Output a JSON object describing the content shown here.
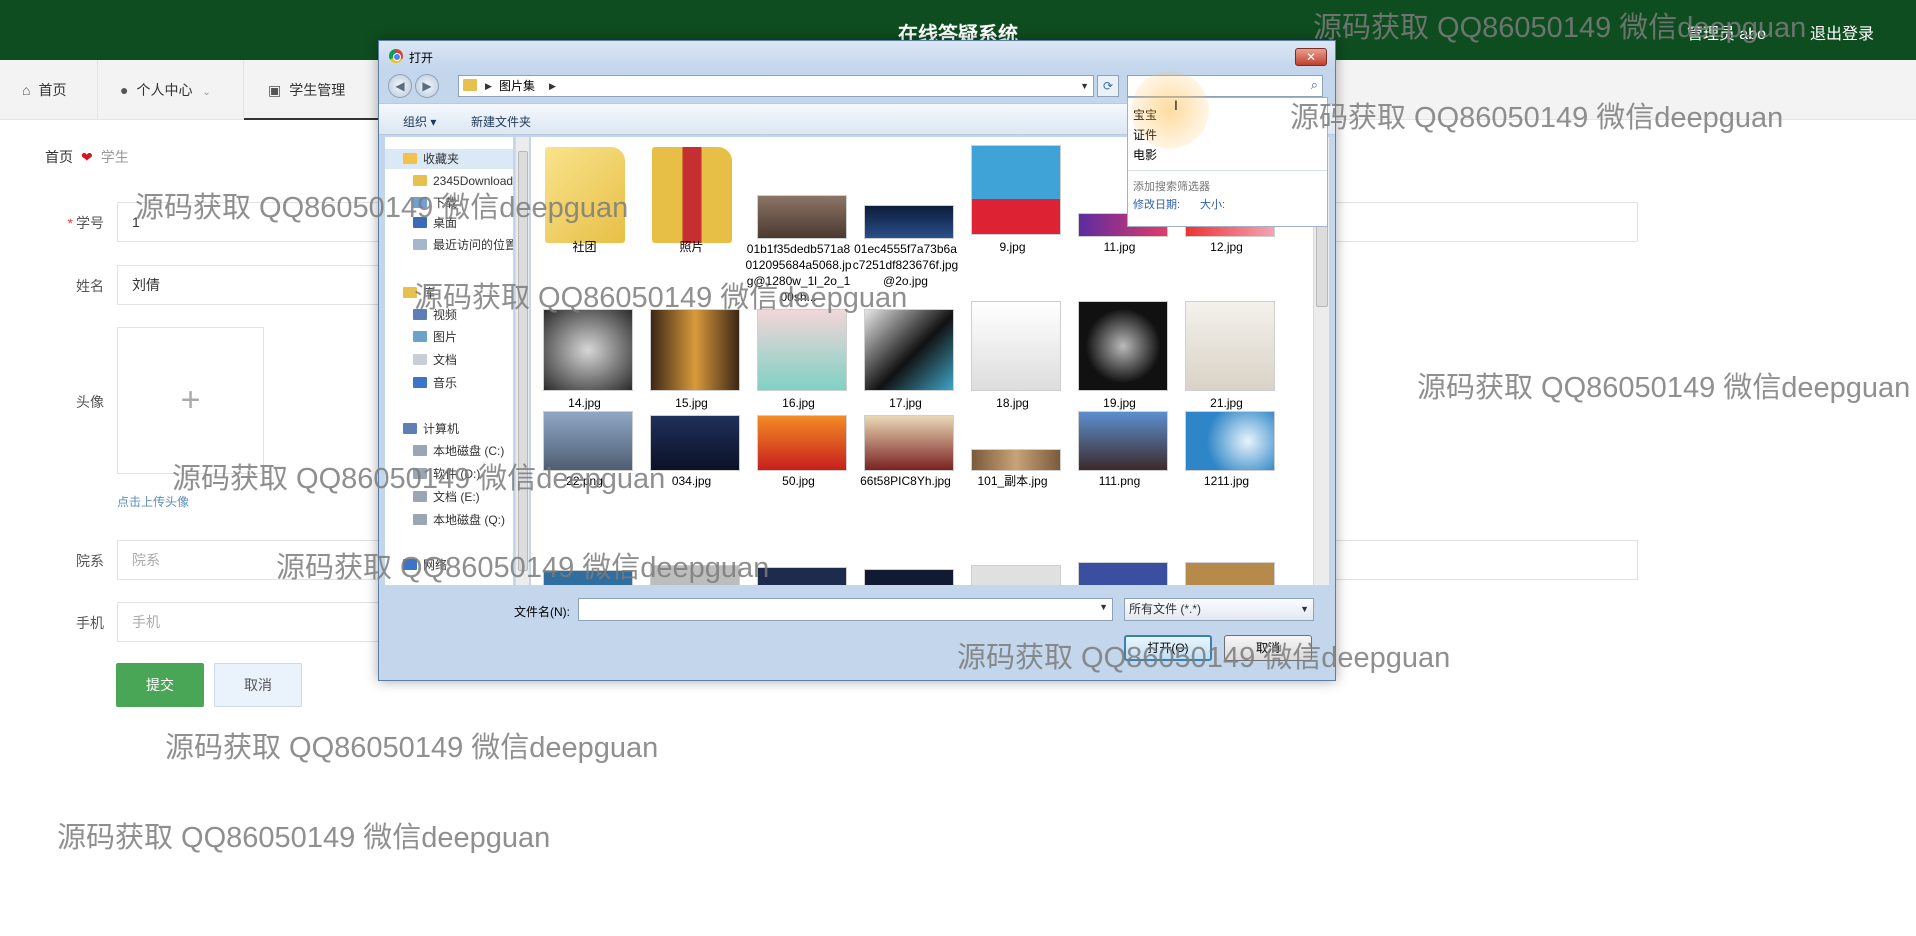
{
  "header": {
    "title": "在线答疑系统",
    "user": "管理员 abo",
    "logout": "退出登录"
  },
  "nav": {
    "home": "首页",
    "personal": "个人中心",
    "student_mgmt": "学生管理"
  },
  "breadcrumb": {
    "home": "首页",
    "current": "学生"
  },
  "form": {
    "student_id_label": "学号",
    "student_id_value": "1",
    "name_label": "姓名",
    "name_value": "刘倩",
    "avatar_label": "头像",
    "upload_plus": "+",
    "upload_hint": "点击上传头像",
    "dept_label": "院系",
    "dept_placeholder": "院系",
    "phone_label": "手机",
    "phone_placeholder": "手机",
    "submit": "提交",
    "cancel": "取消"
  },
  "dialog": {
    "title": "打开",
    "close": "✕",
    "path": "图片集",
    "organize": "组织 ▾",
    "new_folder": "新建文件夹",
    "search_suggestions": [
      "宝宝",
      "证件",
      "电影"
    ],
    "add_filter": "添加搜索筛选器",
    "filter_date": "修改日期:",
    "filter_size": "大小:",
    "nav_pane": [
      "收藏夹",
      "2345Downloads",
      "下载",
      "桌面",
      "最近访问的位置",
      "库",
      "视频",
      "图片",
      "文档",
      "音乐",
      "计算机",
      "本地磁盘 (C:)",
      "软件 (D:)",
      "文档 (E:)",
      "本地磁盘 (Q:)",
      "网络"
    ],
    "files": [
      "社团",
      "照片",
      "01b1f35dedb571a8012095684a5068.jpg@1280w_1l_2o_100sh...",
      "01ec4555f7a73b6ac7251df823676f.jpg@2o.jpg",
      "9.jpg",
      "11.jpg",
      "12.jpg",
      "14.jpg",
      "15.jpg",
      "16.jpg",
      "17.jpg",
      "18.jpg",
      "19.jpg",
      "21.jpg",
      "22.png",
      "034.jpg",
      "50.jpg",
      "66t58PIC8Yh.jpg",
      "101_副本.jpg",
      "111.png",
      "1211.jpg"
    ],
    "filename_label": "文件名(N):",
    "filetype": "所有文件 (*.*)",
    "open": "打开(O)",
    "cancel": "取消"
  },
  "watermark": "源码获取 QQ86050149 微信deepguan",
  "colors": {
    "header_bg": "#0e4d1f",
    "submit_bg": "#4aa657",
    "heart": "#d4141e"
  }
}
